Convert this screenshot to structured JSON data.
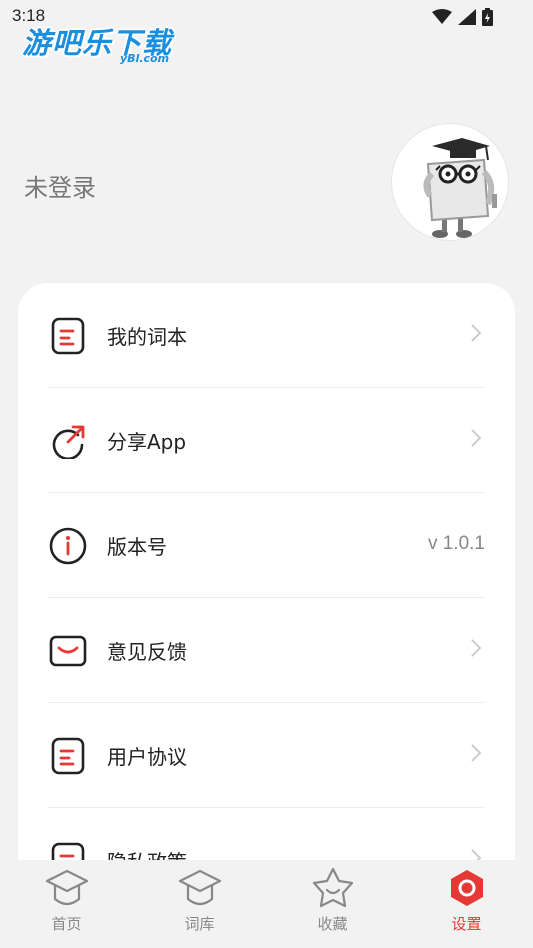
{
  "status_bar": {
    "time": "3:18"
  },
  "watermark": {
    "main": "游吧乐下载",
    "sub": "yBl.com"
  },
  "profile": {
    "login_status": "未登录"
  },
  "menu": {
    "items": [
      {
        "label": "我的词本",
        "icon": "document-icon"
      },
      {
        "label": "分享App",
        "icon": "share-icon"
      },
      {
        "label": "版本号",
        "icon": "info-icon",
        "value": "v 1.0.1"
      },
      {
        "label": "意见反馈",
        "icon": "mail-icon"
      },
      {
        "label": "用户协议",
        "icon": "document-icon"
      },
      {
        "label": "隐私政策",
        "icon": "document-icon"
      }
    ]
  },
  "tabbar": {
    "tabs": [
      {
        "label": "首页",
        "icon": "graduation-cap-icon"
      },
      {
        "label": "词库",
        "icon": "graduation-cap-icon"
      },
      {
        "label": "收藏",
        "icon": "star-face-icon"
      },
      {
        "label": "设置",
        "icon": "settings-icon",
        "active": true
      }
    ]
  },
  "colors": {
    "accent": "#e53935",
    "text": "#222222",
    "muted": "#888888",
    "background": "#f2f2f2"
  }
}
